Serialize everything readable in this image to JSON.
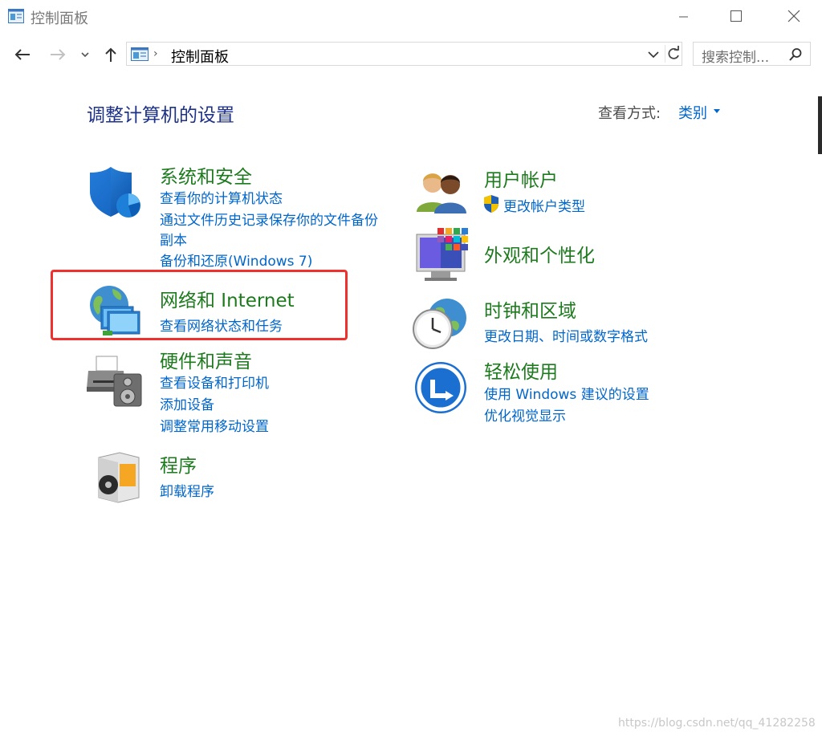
{
  "window": {
    "title": "控制面板"
  },
  "address_bar": {
    "path": "控制面板"
  },
  "search": {
    "placeholder": "搜索控制..."
  },
  "page": {
    "title": "调整计算机的设置",
    "view_label": "查看方式:",
    "view_value": "类别"
  },
  "categories": {
    "system_security": {
      "title": "系统和安全",
      "links": [
        "查看你的计算机状态",
        "通过文件历史记录保存你的文件备份",
        "副本",
        "备份和还原(Windows 7)"
      ]
    },
    "network": {
      "title": "网络和 Internet",
      "links": [
        "查看网络状态和任务"
      ]
    },
    "hardware": {
      "title": "硬件和声音",
      "links": [
        "查看设备和打印机",
        "添加设备",
        "调整常用移动设置"
      ]
    },
    "programs": {
      "title": "程序",
      "links": [
        "卸载程序"
      ]
    },
    "user_accounts": {
      "title": "用户帐户",
      "links": [
        "更改帐户类型"
      ]
    },
    "appearance": {
      "title": "外观和个性化",
      "links": []
    },
    "clock_region": {
      "title": "时钟和区域",
      "links": [
        "更改日期、时间或数字格式"
      ]
    },
    "ease_of_access": {
      "title": "轻松使用",
      "links": [
        "使用 Windows 建议的设置",
        "优化视觉显示"
      ]
    }
  },
  "watermark": "https://blog.csdn.net/qq_41282258",
  "colors": {
    "title_blue": "#1e3287",
    "category_green": "#1e7a1e",
    "link_blue": "#0066cc",
    "highlight_red": "#f0302c"
  }
}
